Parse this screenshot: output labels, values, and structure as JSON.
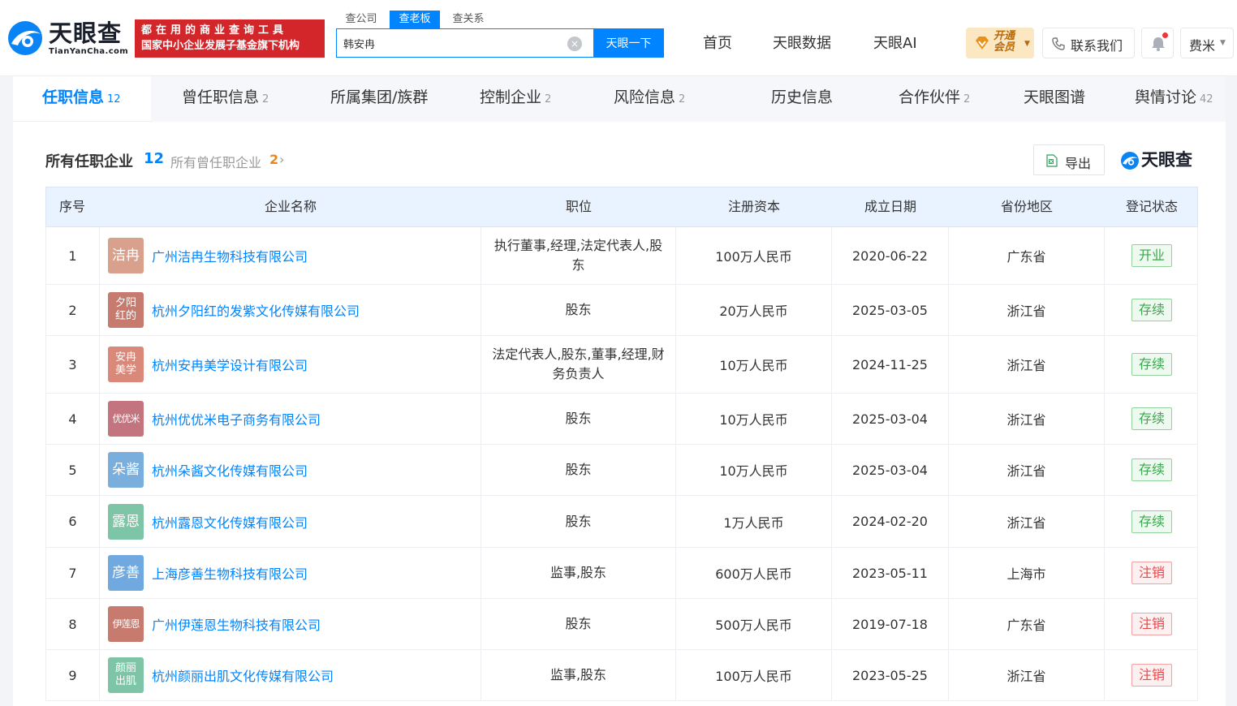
{
  "brand": {
    "logo_cn": "天眼查",
    "logo_en": "TianYanCha.com",
    "promo_line1": "都在用的商业查询工具",
    "promo_line2": "国家中小企业发展子基金旗下机构"
  },
  "search": {
    "tabs": [
      "查公司",
      "查老板",
      "查关系"
    ],
    "active_tab": 1,
    "query": "韩安冉",
    "button": "天眼一下"
  },
  "nav": {
    "items": [
      "首页",
      "天眼数据",
      "天眼AI"
    ],
    "vip": "开通会员",
    "contact": "联系我们",
    "user": "费米"
  },
  "tabs": [
    {
      "label": "任职信息",
      "count": "12"
    },
    {
      "label": "曾任职信息",
      "count": "2"
    },
    {
      "label": "所属集团/族群",
      "count": ""
    },
    {
      "label": "控制企业",
      "count": "2"
    },
    {
      "label": "风险信息",
      "count": "2"
    },
    {
      "label": "历史信息",
      "count": ""
    },
    {
      "label": "合作伙伴",
      "count": "2"
    },
    {
      "label": "天眼图谱",
      "count": ""
    },
    {
      "label": "舆情讨论",
      "count": "42"
    }
  ],
  "section": {
    "title": "所有任职企业",
    "count": "12",
    "former_link": "所有曾任职企业",
    "former_count": "2",
    "export": "导出",
    "watermark": "天眼查"
  },
  "table": {
    "headers": [
      "序号",
      "企业名称",
      "职位",
      "注册资本",
      "成立日期",
      "省份地区",
      "登记状态"
    ],
    "rows": [
      {
        "no": "1",
        "avatar": "洁冉",
        "avatar_color": "#d9a08c",
        "name": "广州洁冉生物科技有限公司",
        "position": "执行董事,经理,法定代表人,股东",
        "capital": "100万人民币",
        "date": "2020-06-22",
        "region": "广东省",
        "status": "开业",
        "status_type": "green"
      },
      {
        "no": "2",
        "avatar": "夕阳红的",
        "avatar_color": "#c77b6e",
        "name": "杭州夕阳红的发紫文化传媒有限公司",
        "position": "股东",
        "capital": "20万人民币",
        "date": "2025-03-05",
        "region": "浙江省",
        "status": "存续",
        "status_type": "green"
      },
      {
        "no": "3",
        "avatar": "安冉美学",
        "avatar_color": "#d9887a",
        "name": "杭州安冉美学设计有限公司",
        "position": "法定代表人,股东,董事,经理,财务负责人",
        "capital": "10万人民币",
        "date": "2024-11-25",
        "region": "浙江省",
        "status": "存续",
        "status_type": "green"
      },
      {
        "no": "4",
        "avatar": "优优米",
        "avatar_color": "#c4747f",
        "name": "杭州优优米电子商务有限公司",
        "position": "股东",
        "capital": "10万人民币",
        "date": "2025-03-04",
        "region": "浙江省",
        "status": "存续",
        "status_type": "green"
      },
      {
        "no": "5",
        "avatar": "朵酱",
        "avatar_color": "#7aaedc",
        "name": "杭州朵酱文化传媒有限公司",
        "position": "股东",
        "capital": "10万人民币",
        "date": "2025-03-04",
        "region": "浙江省",
        "status": "存续",
        "status_type": "green"
      },
      {
        "no": "6",
        "avatar": "露恩",
        "avatar_color": "#7dc5a6",
        "name": "杭州露恩文化传媒有限公司",
        "position": "股东",
        "capital": "1万人民币",
        "date": "2024-02-20",
        "region": "浙江省",
        "status": "存续",
        "status_type": "green"
      },
      {
        "no": "7",
        "avatar": "彦善",
        "avatar_color": "#6fa9e0",
        "name": "上海彦善生物科技有限公司",
        "position": "监事,股东",
        "capital": "600万人民币",
        "date": "2023-05-11",
        "region": "上海市",
        "status": "注销",
        "status_type": "red"
      },
      {
        "no": "8",
        "avatar": "伊莲恩",
        "avatar_color": "#c77b6e",
        "name": "广州伊莲恩生物科技有限公司",
        "position": "股东",
        "capital": "500万人民币",
        "date": "2019-07-18",
        "region": "广东省",
        "status": "注销",
        "status_type": "red"
      },
      {
        "no": "9",
        "avatar": "颜丽出肌",
        "avatar_color": "#7dc5a6",
        "name": "杭州颜丽出肌文化传媒有限公司",
        "position": "监事,股东",
        "capital": "100万人民币",
        "date": "2023-05-25",
        "region": "浙江省",
        "status": "注销",
        "status_type": "red"
      }
    ]
  },
  "colors": {
    "accent": "#0084ff",
    "brand_red": "#d3262b",
    "status_green_text": "#3aa84e",
    "status_green_bg": "#eef9ef",
    "status_green_border": "#92d29c",
    "status_red_text": "#e8474d",
    "status_red_bg": "#fdf0f0",
    "status_red_border": "#f1a2a5"
  }
}
